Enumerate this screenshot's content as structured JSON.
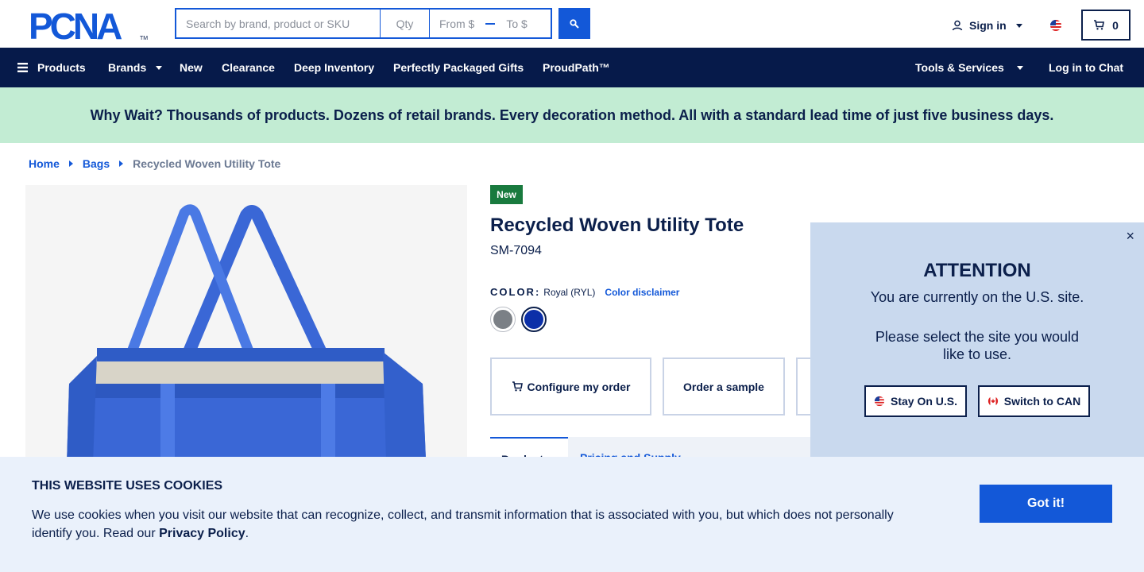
{
  "header": {
    "logo_text": "PCNA",
    "search_placeholder": "Search by brand, product or SKU",
    "qty_placeholder": "Qty",
    "price_from_placeholder": "From $",
    "price_to_placeholder": "To $",
    "search_icon": "search-icon",
    "signin_label": "Sign in",
    "cart_count": "0",
    "country_flag": "us-flag-icon"
  },
  "nav": {
    "products": "Products",
    "brands": "Brands",
    "new": "New",
    "clearance": "Clearance",
    "deep_inventory": "Deep Inventory",
    "perfectly_packaged": "Perfectly Packaged Gifts",
    "proudpath": "ProudPath™",
    "tools_services": "Tools & Services",
    "login_chat": "Log in to Chat"
  },
  "promo": {
    "text": "Why Wait? Thousands of products. Dozens of retail brands. Every decoration method. All with a standard lead time of just five business days."
  },
  "breadcrumb": {
    "home": "Home",
    "bags": "Bags",
    "current": "Recycled Woven Utility Tote"
  },
  "product": {
    "badge": "New",
    "title": "Recycled Woven Utility Tote",
    "sku": "SM-7094",
    "color_label": "COLOR:",
    "color_value": "Royal (RYL)",
    "color_disclaimer": "Color disclaimer",
    "swatches": [
      {
        "name": "Gray",
        "hex": "#7b8086"
      },
      {
        "name": "Royal",
        "hex": "#0b2fa8"
      }
    ],
    "tote_color": "#3a67d6",
    "configure_label": "Configure my order",
    "sample_label": "Order a sample",
    "tab_product": "Product",
    "tab_pricing": "Pricing and Supply"
  },
  "site_modal": {
    "close": "×",
    "title": "ATTENTION",
    "line1": "You are currently on the U.S. site.",
    "line2": "Please select the site you would like to use.",
    "stay_label": "Stay On U.S.",
    "switch_label": "Switch to CAN"
  },
  "cookie": {
    "title": "THIS WEBSITE USES COOKIES",
    "text": "We use cookies when you visit our website that can recognize, collect, and transmit information that is associated with you, but which does not personally identify you. Read our ",
    "policy_link": "Privacy Policy",
    "period": ".",
    "button": "Got it!"
  },
  "colors": {
    "navy": "#061a4a",
    "blue": "#1358d8",
    "promo_bg": "#c2ecd3",
    "badge_green": "#197a3e",
    "modal_bg": "#c9d9ee",
    "cookie_bg": "#eaf1fb"
  }
}
